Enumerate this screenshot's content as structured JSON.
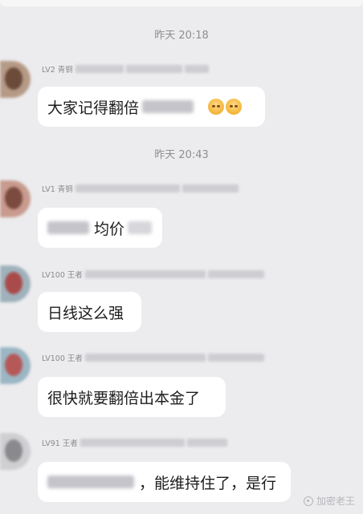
{
  "timestamps": [
    "昨天 20:18",
    "昨天 20:43"
  ],
  "messages": [
    {
      "level": "LV2 青铜",
      "text_pre": "大家记得翻倍",
      "text_post": "",
      "emoji": [
        "sweat-smile-emoji",
        "crying-emoji"
      ]
    },
    {
      "level": "LV1 青铜",
      "text_pre": "",
      "text_post": "均价"
    },
    {
      "level": "LV100 王者",
      "text_pre": "日线这么强",
      "text_post": ""
    },
    {
      "level": "LV100 王者",
      "text_pre": "很快就要翻倍出本金了",
      "text_post": ""
    },
    {
      "level": "LV91 王者",
      "text_pre": "",
      "text_post": "，能维持住了，是行"
    }
  ],
  "watermark": {
    "text": "加密老王",
    "icon": "platform-logo-icon"
  },
  "colors": {
    "background": "#ececee",
    "bubble": "#ffffff",
    "timestamp": "#8e8e93"
  }
}
